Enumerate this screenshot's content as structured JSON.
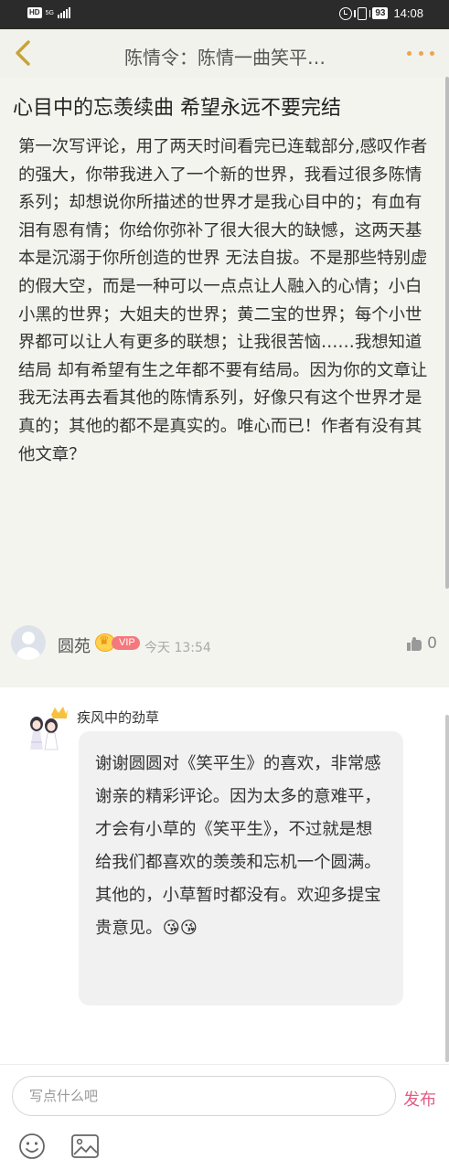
{
  "status_bar": {
    "hd": "HD",
    "network": "5G",
    "battery": "93",
    "time": "14:08"
  },
  "header": {
    "title": "陈情令：陈情一曲笑平…"
  },
  "review": {
    "title": "心目中的忘羡续曲 希望永远不要完结",
    "body": "第一次写评论，用了两天时间看完已连载部分,感叹作者的强大，你带我进入了一个新的世界，我看过很多陈情系列；却想说你所描述的世界才是我心目中的；有血有泪有恩有情；你给你弥补了很大很大的缺憾，这两天基本是沉溺于你所创造的世界 无法自拔。不是那些特别虚的假大空，而是一种可以一点点让人融入的心情；小白小黑的世界；大姐夫的世界；黄二宝的世界；每个小世界都可以让人有更多的联想；让我很苦恼……我想知道结局 却有希望有生之年都不要有结局。因为你的文章让我无法再去看其他的陈情系列，好像只有这个世界才是真的；其他的都不是真实的。唯心而已！作者有没有其他文章？",
    "author": "圆苑",
    "vip": "VIP",
    "time": "今天 13:54",
    "likes": "0"
  },
  "reply": {
    "author": "疾风中的劲草",
    "text": "谢谢圆圆对《笑平生》的喜欢，非常感谢亲的精彩评论。因为太多的意难平，才会有小草的《笑平生》，不过就是想给我们都喜欢的羡羡和忘机一个圆满。其他的，小草暂时都没有。欢迎多提宝贵意见。😘😘"
  },
  "composer": {
    "placeholder": "写点什么吧",
    "publish_label": "发布"
  },
  "colors": {
    "accent": "#e35b83",
    "back_arrow": "#c8a23a",
    "more_dots": "#f0a34a",
    "review_bg": "#f4f4ee"
  }
}
